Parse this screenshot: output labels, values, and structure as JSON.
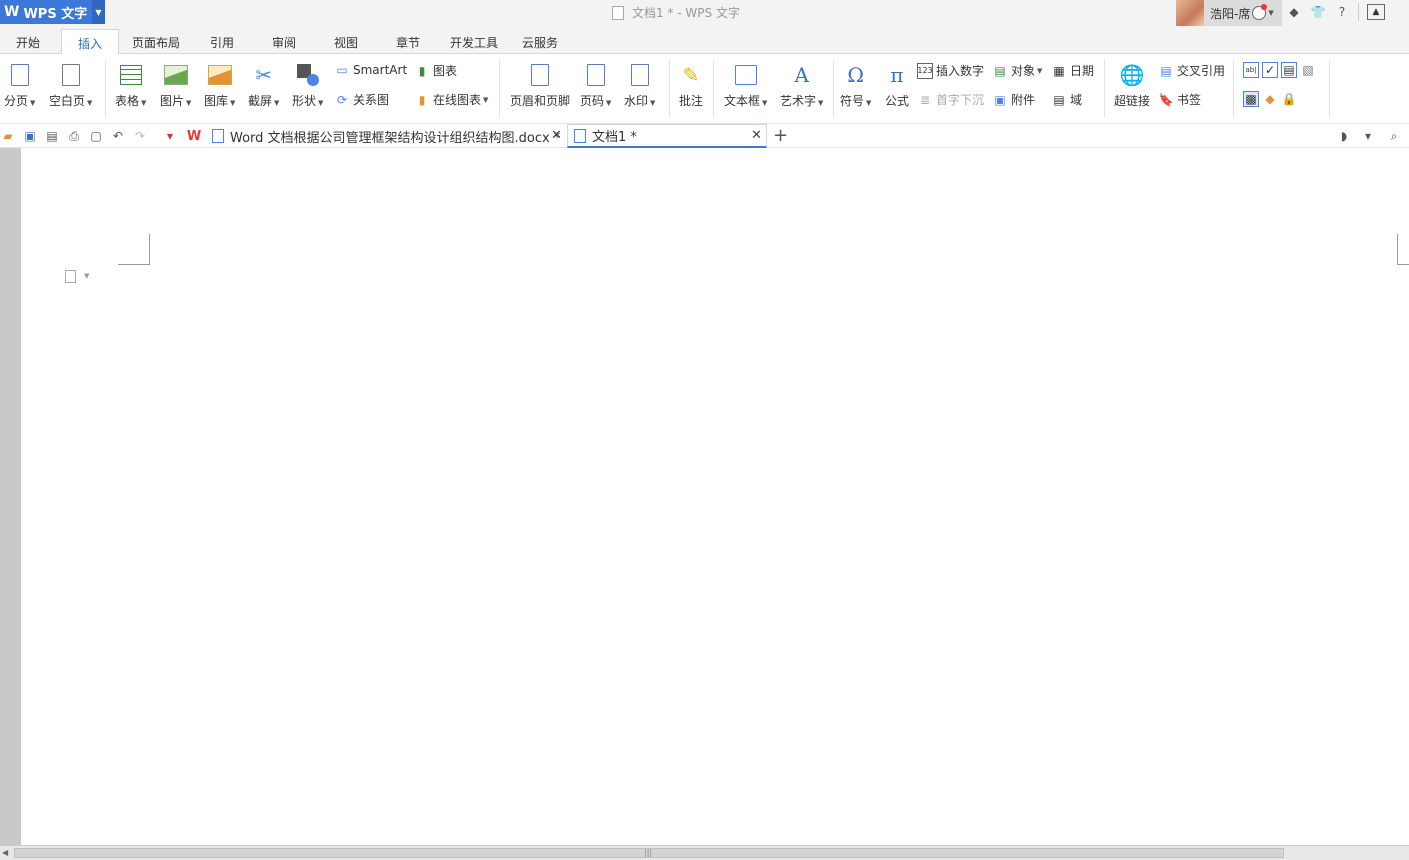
{
  "app": {
    "logo_letter": "W",
    "name": "WPS 文字",
    "window_title": "文档1 * - WPS 文字"
  },
  "user": {
    "name": "浩阳-席"
  },
  "menu": {
    "tabs": [
      "开始",
      "插入",
      "页面布局",
      "引用",
      "审阅",
      "视图",
      "章节",
      "开发工具",
      "云服务"
    ],
    "active": "插入"
  },
  "ribbon": {
    "page_break": "分页",
    "blank_page": "空白页",
    "table": "表格",
    "picture": "图片",
    "gallery": "图库",
    "screenshot": "截屏",
    "shape": "形状",
    "smartart": "SmartArt",
    "chart": "图表",
    "relation": "关系图",
    "online_chart": "在线图表",
    "header_footer": "页眉和页脚",
    "page_number": "页码",
    "watermark": "水印",
    "comment": "批注",
    "textbox": "文本框",
    "wordart": "艺术字",
    "symbol": "符号",
    "equation": "公式",
    "insert_number": "插入数字",
    "object": "对象",
    "date": "日期",
    "drop_cap": "首字下沉",
    "attachment": "附件",
    "field": "域",
    "hyperlink": "超链接",
    "cross_ref": "交叉引用",
    "bookmark": "书签"
  },
  "doc_tabs": [
    {
      "title": "Word 文档根据公司管理框架结构设计组织结构图.docx *"
    },
    {
      "title": "文档1 *"
    }
  ],
  "colors": {
    "accent": "#3b78d8",
    "wps_red": "#e33333"
  }
}
